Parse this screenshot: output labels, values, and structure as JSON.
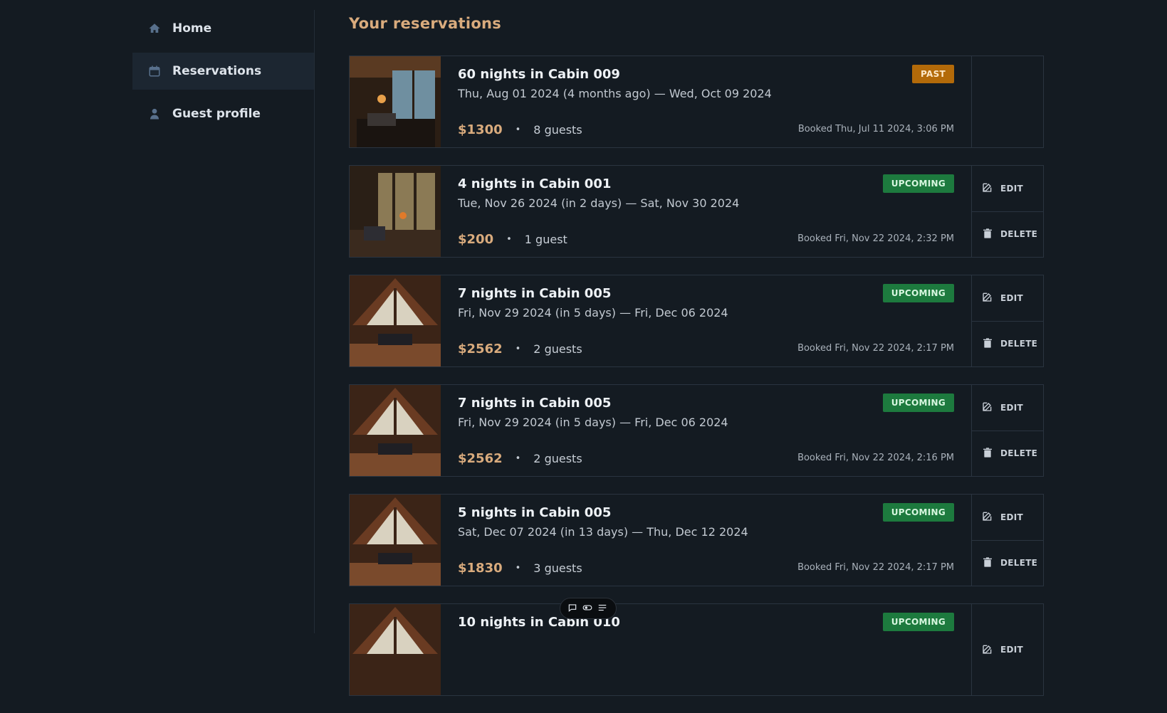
{
  "sidebar": {
    "items": [
      {
        "label": "Home",
        "icon": "home-icon"
      },
      {
        "label": "Reservations",
        "icon": "calendar-icon",
        "active": true
      },
      {
        "label": "Guest profile",
        "icon": "user-icon"
      }
    ]
  },
  "main": {
    "title": "Your reservations",
    "actions": {
      "edit": "EDIT",
      "delete": "DELETE"
    },
    "reservations": [
      {
        "title": "60 nights in Cabin 009",
        "dates": "Thu, Aug 01 2024 (4 months ago) — Wed, Oct 09 2024",
        "price": "$1300",
        "guests": "8 guests",
        "booked": "Booked Thu, Jul 11 2024, 3:06 PM",
        "status": "PAST"
      },
      {
        "title": "4 nights in Cabin 001",
        "dates": "Tue, Nov 26 2024 (in 2 days) — Sat, Nov 30 2024",
        "price": "$200",
        "guests": "1 guest",
        "booked": "Booked Fri, Nov 22 2024, 2:32 PM",
        "status": "UPCOMING"
      },
      {
        "title": "7 nights in Cabin 005",
        "dates": "Fri, Nov 29 2024 (in 5 days) — Fri, Dec 06 2024",
        "price": "$2562",
        "guests": "2 guests",
        "booked": "Booked Fri, Nov 22 2024, 2:17 PM",
        "status": "UPCOMING"
      },
      {
        "title": "7 nights in Cabin 005",
        "dates": "Fri, Nov 29 2024 (in 5 days) — Fri, Dec 06 2024",
        "price": "$2562",
        "guests": "2 guests",
        "booked": "Booked Fri, Nov 22 2024, 2:16 PM",
        "status": "UPCOMING"
      },
      {
        "title": "5 nights in Cabin 005",
        "dates": "Sat, Dec 07 2024 (in 13 days) — Thu, Dec 12 2024",
        "price": "$1830",
        "guests": "3 guests",
        "booked": "Booked Fri, Nov 22 2024, 2:17 PM",
        "status": "UPCOMING"
      },
      {
        "title": "10 nights in Cabin 010",
        "dates": "",
        "price": "",
        "guests": "",
        "booked": "",
        "status": "UPCOMING"
      }
    ]
  },
  "colors": {
    "accent": "#d9ab7d",
    "past": "#b36a09",
    "upcoming": "#1d7a3e",
    "background": "#141b22"
  }
}
